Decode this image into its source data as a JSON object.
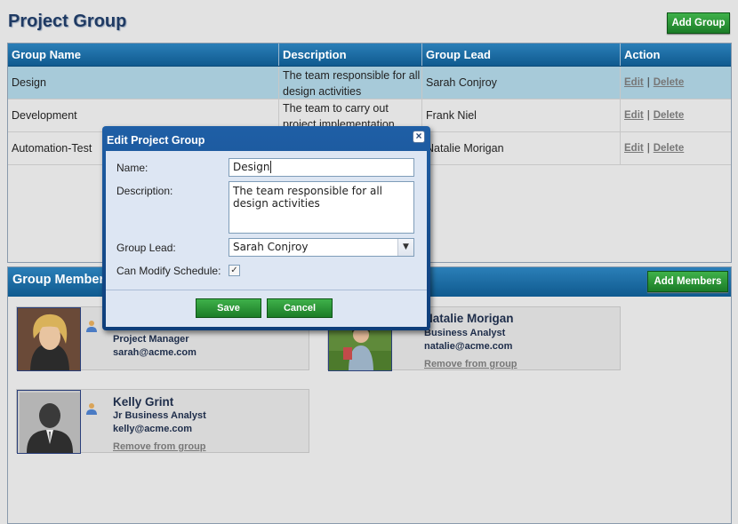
{
  "page": {
    "title": "Project Group",
    "add_group_label": "Add Group"
  },
  "table": {
    "headers": [
      "Group Name",
      "Description",
      "Group Lead",
      "Action"
    ],
    "rows": [
      {
        "name": "Design",
        "description": "The team responsible for all design activities",
        "lead": "Sarah Conjroy",
        "edit": "Edit",
        "sep": "|",
        "delete": "Delete"
      },
      {
        "name": "Development",
        "description": "The team to carry out project implementation",
        "lead": "Frank Niel",
        "edit": "Edit",
        "sep": "|",
        "delete": "Delete"
      },
      {
        "name": "Automation-Test",
        "description": "",
        "lead": "Natalie Morigan",
        "edit": "Edit",
        "sep": "|",
        "delete": "Delete"
      }
    ]
  },
  "members": {
    "title": "Group Members",
    "add_members_label": "Add Members",
    "cards": [
      {
        "name": "",
        "role": "Project Manager",
        "email": "sarah@acme.com",
        "remove": ""
      },
      {
        "name": "Natalie Morigan",
        "role": "Business Analyst",
        "email": "natalie@acme.com",
        "remove": "Remove from group"
      },
      {
        "name": "Kelly Grint",
        "role": "Jr Business Analyst",
        "email": "kelly@acme.com",
        "remove": "Remove from group"
      }
    ]
  },
  "dialog": {
    "title": "Edit Project Group",
    "close_icon": "×",
    "name_label": "Name:",
    "name_value": "Design",
    "description_label": "Description:",
    "description_value": "The team responsible for all design activities",
    "lead_label": "Group Lead:",
    "lead_value": "Sarah Conjroy",
    "modify_label": "Can Modify Schedule:",
    "modify_checked": true,
    "save_label": "Save",
    "cancel_label": "Cancel"
  },
  "colors": {
    "header_blue": "#0f5a8f",
    "selected_row": "#a7cad9",
    "button_green": "#1b7c27",
    "dialog_blue": "#1f5fa6"
  }
}
